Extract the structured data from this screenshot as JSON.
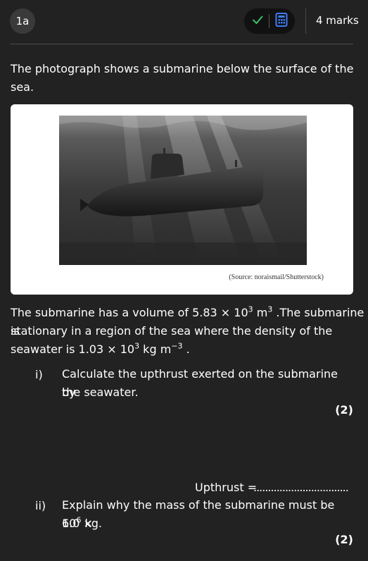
{
  "header": {
    "question_number": "1a",
    "marks_label": "4 marks",
    "accent": "#3f7cf0",
    "check_color": "#3ec06a"
  },
  "intro": {
    "line1": "The photograph shows a submarine below the surface of the",
    "line2": "sea."
  },
  "figure": {
    "source": "(Source: noraismail/Shutterstock)"
  },
  "body": {
    "l1_a": "The submarine has a volume of 5.83 × 10",
    "l1_sup": "3",
    "l1_b": " m",
    "l1_sup2": "3",
    "l1_c": " .The submarine is",
    "l2": "stationary in a region of the sea where the density of the",
    "l3_a": "seawater is 1.03 × 10",
    "l3_sup": "3",
    "l3_b": " kg m",
    "l3_sup2": "−3",
    "l3_c": " ."
  },
  "parts": [
    {
      "number": "i)",
      "line1": "Calculate the upthrust exerted on the submarine by",
      "line2": "the seawater.",
      "marks": "(2)",
      "answer_label": "Upthrust =",
      "answer_dots": "................................."
    },
    {
      "number": "ii)",
      "line1": "Explain why the mass of the submarine must be 6.0 ×",
      "line2_a": "10",
      "line2_sup": "6",
      "line2_b": " kg.",
      "marks": "(2)"
    }
  ]
}
